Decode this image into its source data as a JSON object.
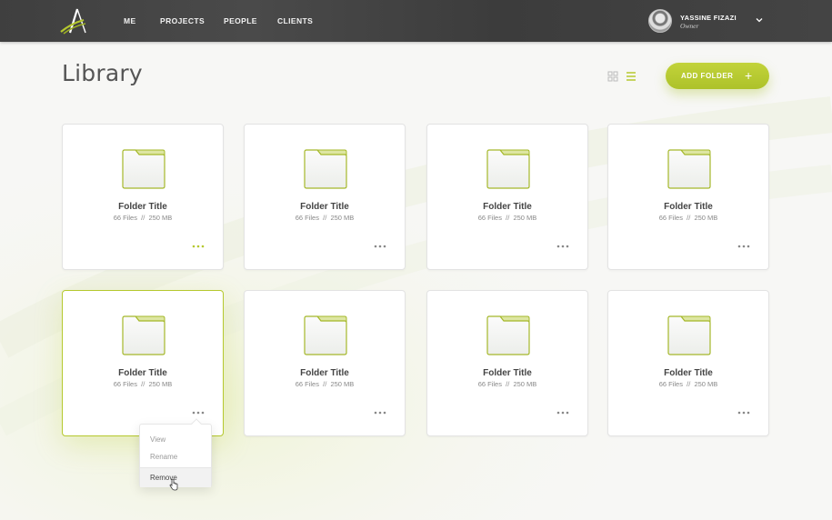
{
  "nav": {
    "items": [
      {
        "label": "ME"
      },
      {
        "label": "PROJECTS"
      },
      {
        "label": "PEOPLE"
      },
      {
        "label": "CLIENTS"
      }
    ]
  },
  "user": {
    "name": "YASSINE FIZAZI",
    "role": "Owner"
  },
  "page": {
    "title": "Library",
    "add_button_label": "ADD FOLDER",
    "add_button_icon": "+"
  },
  "colors": {
    "accent": "#b5c82e",
    "topbar": "#424242"
  },
  "folders": [
    {
      "title": "Folder Title",
      "meta": "66 Files  //  250 MB",
      "more_active": true
    },
    {
      "title": "Folder Title",
      "meta": "66 Files  //  250 MB"
    },
    {
      "title": "Folder Title",
      "meta": "66 Files  //  250 MB"
    },
    {
      "title": "Folder Title",
      "meta": "66 Files  //  250 MB"
    },
    {
      "title": "Folder Title",
      "meta": "66 Files  //  250 MB",
      "selected": true
    },
    {
      "title": "Folder Title",
      "meta": "66 Files  //  250 MB"
    },
    {
      "title": "Folder Title",
      "meta": "66 Files  //  250 MB"
    },
    {
      "title": "Folder Title",
      "meta": "66 Files  //  250 MB"
    }
  ],
  "context_menu": {
    "items": [
      {
        "label": "View"
      },
      {
        "label": "Rename"
      },
      {
        "label": "Remove"
      }
    ]
  }
}
